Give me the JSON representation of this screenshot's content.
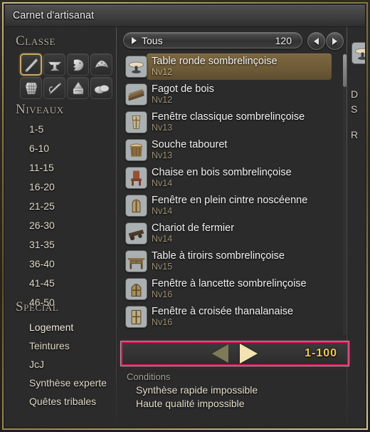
{
  "window": {
    "title": "Carnet d'artisanat"
  },
  "sidebar": {
    "classe_heading": "Classe",
    "class_icons": [
      {
        "name": "carpenter-saw-icon",
        "selected": true
      },
      {
        "name": "blacksmith-anvil-icon",
        "selected": false
      },
      {
        "name": "armorer-helmet-icon",
        "selected": false
      },
      {
        "name": "goldsmith-tiara-icon",
        "selected": false
      },
      {
        "name": "leatherworker-hide-icon",
        "selected": false
      },
      {
        "name": "weaver-needle-icon",
        "selected": false
      },
      {
        "name": "alchemist-alembic-icon",
        "selected": false
      },
      {
        "name": "culinarian-bread-icon",
        "selected": false
      }
    ],
    "niveaux_heading": "Niveaux",
    "levels": [
      "1-5",
      "6-10",
      "11-15",
      "16-20",
      "21-25",
      "26-30",
      "31-35",
      "36-40",
      "41-45",
      "46-50"
    ],
    "special_heading": "Spécial",
    "special": [
      {
        "label": "Logement",
        "selected": true
      },
      {
        "label": "Teintures",
        "selected": false
      },
      {
        "label": "JcJ",
        "selected": false
      },
      {
        "label": "Synthèse experte",
        "selected": false
      },
      {
        "label": "Quêtes tribales",
        "selected": false
      }
    ]
  },
  "center": {
    "filter": {
      "label": "Tous",
      "count": "120",
      "prev_icon": "chevron-left-icon",
      "next_icon": "chevron-right-icon"
    },
    "items": [
      {
        "name": "Table ronde sombrelinçoise",
        "level": "Nv12",
        "icon": "round-table-icon",
        "selected": true
      },
      {
        "name": "Fagot de bois",
        "level": "Nv12",
        "icon": "firewood-bundle-icon",
        "selected": false
      },
      {
        "name": "Fenêtre classique sombrelinçoise",
        "level": "Nv13",
        "icon": "classic-window-icon",
        "selected": false
      },
      {
        "name": "Souche tabouret",
        "level": "Nv13",
        "icon": "stump-stool-icon",
        "selected": false
      },
      {
        "name": "Chaise en bois sombrelinçoise",
        "level": "Nv14",
        "icon": "wooden-chair-icon",
        "selected": false
      },
      {
        "name": "Fenêtre en plein cintre noscéenne",
        "level": "Nv14",
        "icon": "arched-window-icon",
        "selected": false
      },
      {
        "name": "Chariot de fermier",
        "level": "Nv14",
        "icon": "farmers-cart-icon",
        "selected": false
      },
      {
        "name": "Table à tiroirs sombrelinçoise",
        "level": "Nv15",
        "icon": "drawer-table-icon",
        "selected": false
      },
      {
        "name": "Fenêtre à lancette sombrelinçoise",
        "level": "Nv16",
        "icon": "lancet-window-icon",
        "selected": false
      },
      {
        "name": "Fenêtre à croisée thanalanaise",
        "level": "Nv16",
        "icon": "casement-window-icon",
        "selected": false
      }
    ],
    "pagination": {
      "prev_icon": "triangle-left-icon",
      "next_icon": "triangle-right-icon",
      "range": "1-100"
    },
    "conditions": {
      "heading": "Conditions",
      "lines": [
        "Synthèse rapide impossible",
        "Haute qualité impossible"
      ]
    }
  },
  "right_panel": {
    "item_icon": "selected-item-icon",
    "line1": "D",
    "line2": "S",
    "line3": "R"
  },
  "colors": {
    "gold_frame": "#c9b98a",
    "accent_pink": "#e8185f",
    "selection_brown": "#7d6840",
    "range_gold": "#f0c75e",
    "text_primary": "#f2f2f2",
    "text_level": "#9c8f74",
    "panel_bg": "#2b2b2b"
  }
}
